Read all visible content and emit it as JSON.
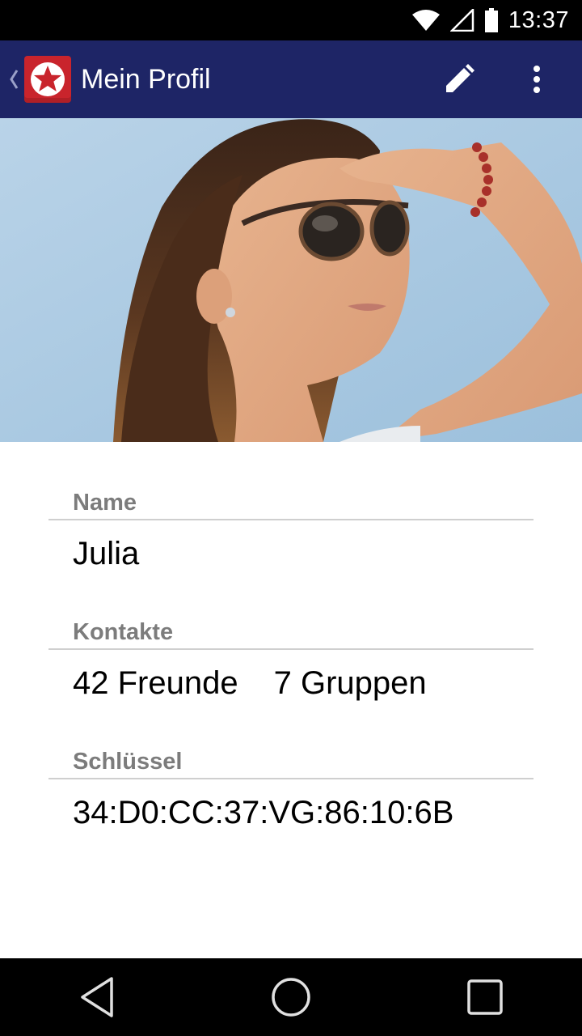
{
  "status_bar": {
    "time": "13:37",
    "icons": [
      "wifi-icon",
      "signal-icon",
      "battery-icon"
    ]
  },
  "app_bar": {
    "title": "Mein Profil",
    "background_color": "#1e2566",
    "logo_color": "#c9242c",
    "actions": [
      "edit-icon",
      "overflow-menu-icon"
    ]
  },
  "profile": {
    "photo_description_icon": "profile-header-photo",
    "name_label": "Name",
    "name_value": "Julia",
    "contacts_label": "Kontakte",
    "friends": "42 Freunde",
    "groups": "7 Gruppen",
    "key_label": "Schlüssel",
    "key_value": "34:D0:CC:37:VG:86:10:6B"
  },
  "nav_bar": {
    "buttons": [
      "back-triangle-icon",
      "home-circle-icon",
      "recents-square-icon"
    ]
  }
}
